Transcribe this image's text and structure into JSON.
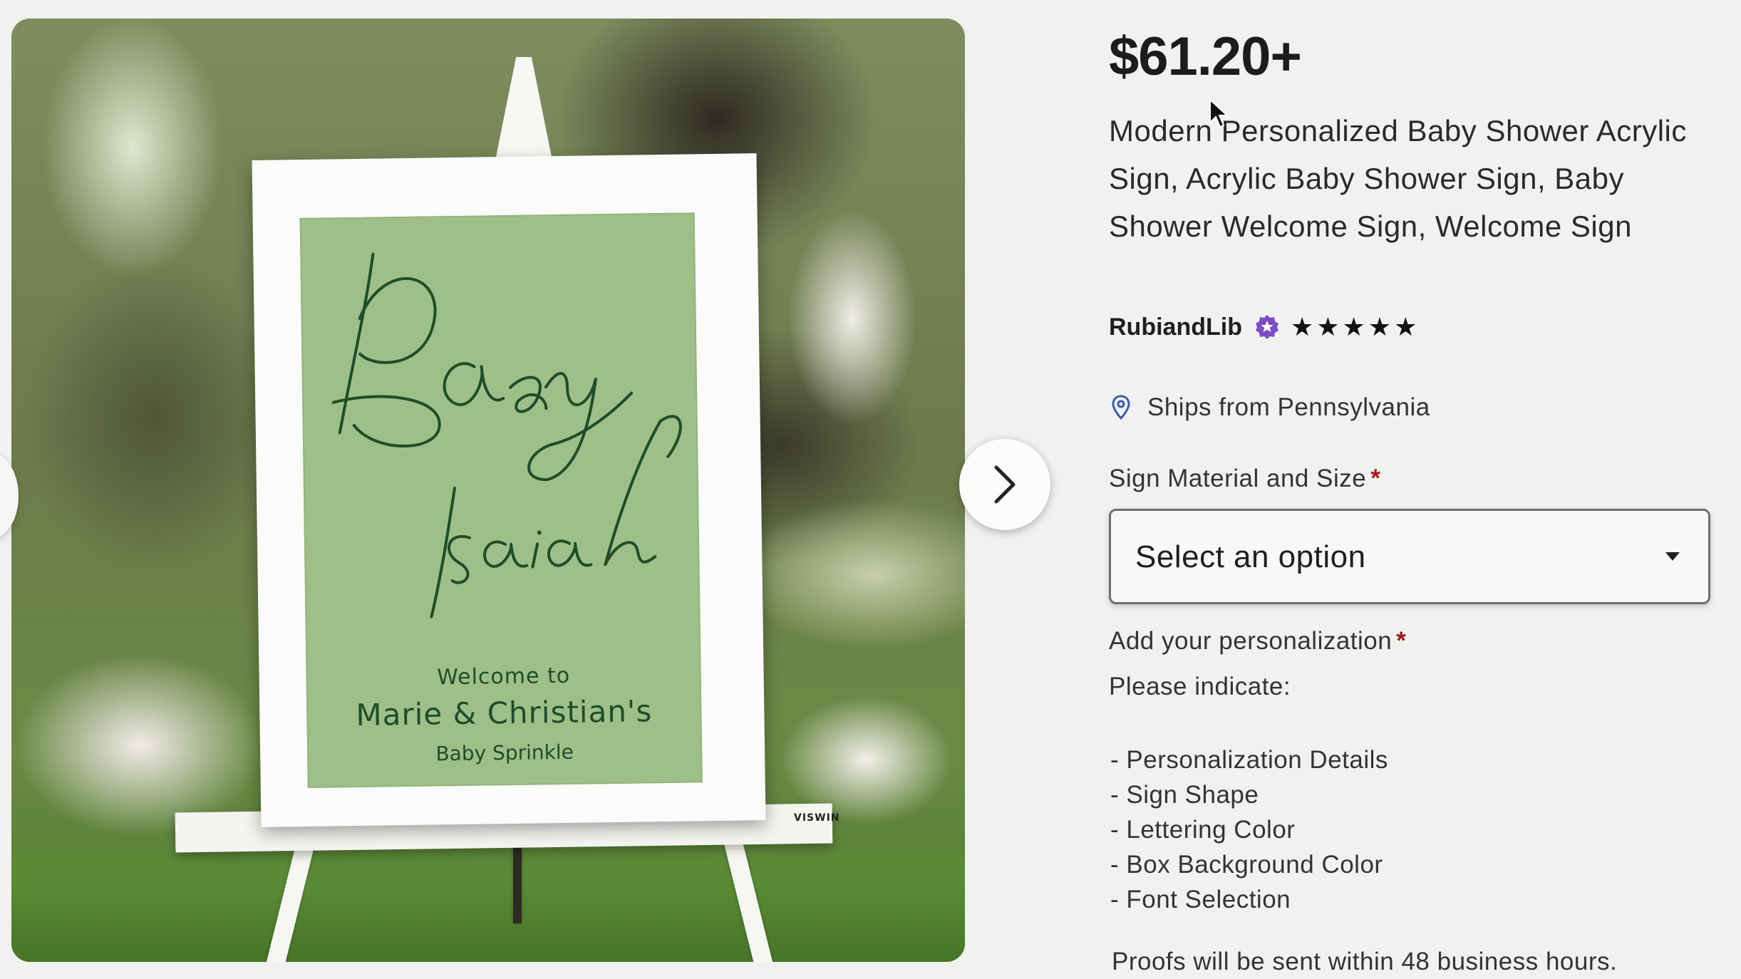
{
  "listing": {
    "price": "$61.20+",
    "title": "Modern Personalized Baby Shower Acrylic Sign, Acrylic Baby Shower Sign, Baby Shower Welcome Sign, Welcome Sign",
    "shop_name": "RubiandLib",
    "star_seller_icon": "star-seller-badge-icon",
    "rating": 5,
    "ships_from": "Ships from Pennsylvania"
  },
  "image": {
    "sign": {
      "line1": "Baby",
      "line2": "Isaiah",
      "welcome": "Welcome to",
      "names": "Marie & Christian's",
      "event": "Baby Sprinkle",
      "brand": "VISWIN"
    },
    "next_icon": "chevron-right-icon"
  },
  "variation": {
    "label": "Sign Material and Size",
    "required_mark": "*",
    "placeholder": "Select an option"
  },
  "personalization": {
    "label": "Add your personalization",
    "required_mark": "*",
    "intro": "Please indicate:",
    "items": [
      "- Personalization Details",
      "- Sign Shape",
      "- Lettering Color",
      "- Box Background Color",
      "- Font Selection"
    ],
    "note": "Proofs will be sent within 48 business hours."
  },
  "colors": {
    "sign_green": "#9ebf88",
    "script_green": "#1f4d2a",
    "star_seller_purple": "#7b4cc6",
    "required_red": "#9e1b1b"
  }
}
